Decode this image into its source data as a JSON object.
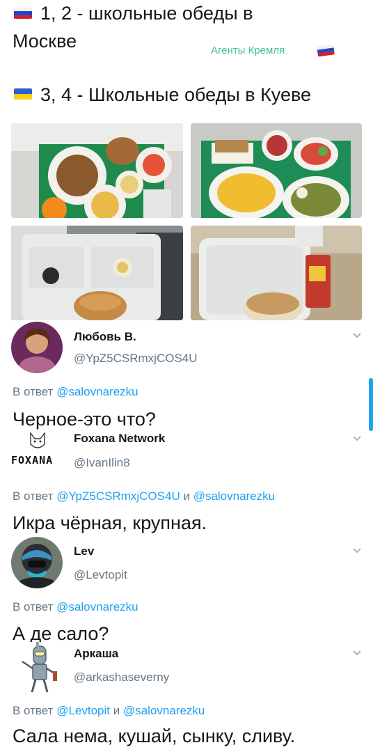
{
  "header": {
    "line1": "1, 2 - школьные обеды в",
    "line2": "Москве",
    "watermark": "Агенты Кремля",
    "line3": "3, 4 - Школьные обеды в Куеве"
  },
  "replies": [
    {
      "name": "Любовь В.",
      "handle": "@YpZ5CSRmxjCOS4U",
      "reply_prefix": "В ответ",
      "reply_to_1": "@salovnarezku",
      "reply_joiner": "",
      "reply_to_2": "",
      "text": "Черное-это что?"
    },
    {
      "name": "Foxana Network",
      "handle": "@IvanIlin8",
      "avatar_label": "FOXANA",
      "reply_prefix": "В ответ",
      "reply_to_1": "@YpZ5CSRmxjCOS4U",
      "reply_joiner": "и",
      "reply_to_2": "@salovnarezku",
      "text": "Икра чёрная, крупная."
    },
    {
      "name": "Lev",
      "handle": "@Levtopit",
      "reply_prefix": "В ответ",
      "reply_to_1": "@salovnarezku",
      "reply_joiner": "",
      "reply_to_2": "",
      "text": "А де сало?"
    },
    {
      "name": "Аркаша",
      "handle": "@arkashaseverny",
      "reply_prefix": "В ответ",
      "reply_to_1": "@Levtopit",
      "reply_joiner": "и",
      "reply_to_2": "@salovnarezku",
      "text": "Сала нема, кушай, сынку, сливу."
    }
  ],
  "colors": {
    "link": "#1da1f2",
    "muted": "#657786",
    "text": "#14171a",
    "watermark": "#45c28a"
  },
  "icons": [
    "russia-flag-icon",
    "ukraine-flag-icon",
    "chevron-down-icon"
  ]
}
